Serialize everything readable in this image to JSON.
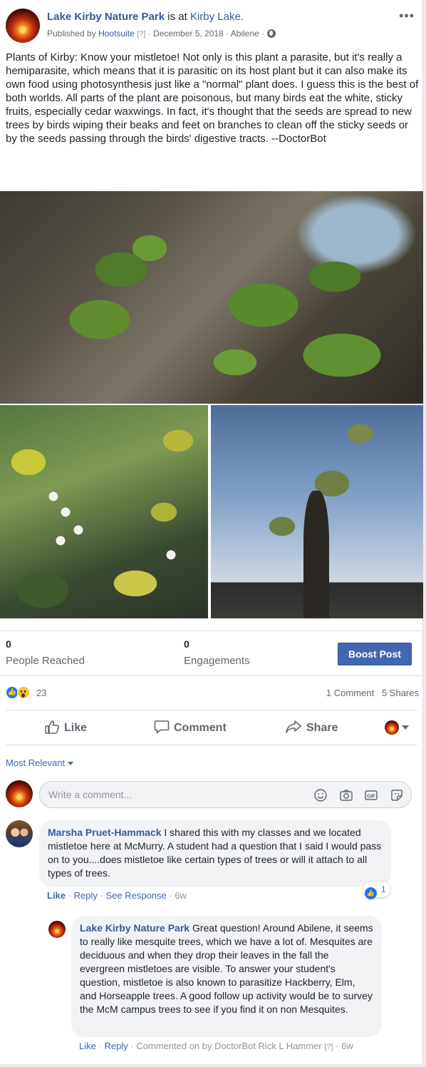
{
  "post": {
    "page_name": "Lake Kirby Nature Park",
    "is_at": "is at",
    "place": "Kirby Lake.",
    "published_by": "Published by",
    "publisher": "Hootsuite",
    "publisher_tag": "[?]",
    "date": "December 5, 2018",
    "location": "Abilene",
    "sep": "·",
    "more": "•••",
    "text": "Plants of Kirby: Know your mistletoe! Not only is this plant a parasite, but it's really a hemiparasite, which means that it is parasitic on its host plant but it can also make its own food using photosynthesis just like a \"normal\" plant does. I guess this is the best of both worlds. All parts of the plant are poisonous, but many birds eat the white, sticky fruits, especially cedar waxwings. In fact, it's thought that the seeds are spread to new trees by birds wiping their beaks and feet on branches to clean off the sticky seeds or by the seeds passing through the birds' digestive tracts. --DoctorBot"
  },
  "insights": {
    "reached_value": "0",
    "reached_label": "People Reached",
    "engagements_value": "0",
    "engagements_label": "Engagements",
    "boost_label": "Boost Post"
  },
  "reactions": {
    "count": "23",
    "comments": "1 Comment",
    "shares": "5 Shares"
  },
  "actions": {
    "like": "Like",
    "comment": "Comment",
    "share": "Share"
  },
  "comments_section": {
    "sort_label": "Most Relevant",
    "compose_placeholder": "Write a comment..."
  },
  "comment1": {
    "author": "Marsha Pruet-Hammack",
    "text": "I shared this with my classes and we located mistletoe here at McMurry. A student had a question that I said I would pass on to you....does mistletoe like certain types of trees or will it attach to all types of trees.",
    "like": "Like",
    "reply": "Reply",
    "see_response": "See Response",
    "time": "6w",
    "likes": "1",
    "sep": "·"
  },
  "reply1": {
    "author": "Lake Kirby Nature Park",
    "text": "Great question! Around Abilene, it seems to really like mesquite trees, which we have a lot of. Mesquites are deciduous and when they drop their leaves in the fall the evergreen mistletoes are visible. To answer your student's question, mistletoe is also known to parasitize Hackberry, Elm, and Horseapple trees. A good follow up activity would be to survey the McM campus trees to see if you find it on non Mesquites.",
    "like": "Like",
    "reply": "Reply",
    "commented_on": "Commented on by DoctorBot Rick L Hammer",
    "tag": "[?]",
    "time": "6w",
    "sep": "·"
  },
  "colors": {
    "link": "#385898",
    "button": "#4267b2",
    "text": "#1d2129",
    "muted": "#606770"
  }
}
